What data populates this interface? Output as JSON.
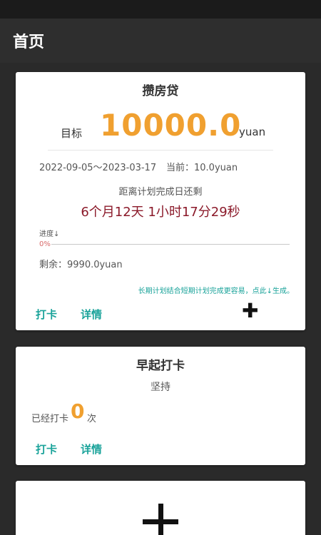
{
  "app": {
    "title": "首页"
  },
  "plan_card": {
    "title": "攒房贷",
    "target_label": "目标",
    "target_amount": "10000.0",
    "target_unit": "yuan",
    "date_range": "2022-09-05～2023-03-17",
    "current": "当前：10.0yuan",
    "remain_label": "距离计划完成日还剩",
    "countdown": "6个月12天 1小时17分29秒",
    "progress_label": "进度↓",
    "progress_percent_text": "0%",
    "progress_value": 0,
    "balance": "剩余：9990.0yuan",
    "hint": "长期计划结合短期计划完成更容易，点此↓生成。",
    "checkin_label": "打卡",
    "details_label": "详情",
    "add_icon": "plus-icon"
  },
  "habit_card": {
    "title": "早起打卡",
    "persist_label": "坚持",
    "count_prefix": "已经打卡",
    "count": "0",
    "count_suffix": "次",
    "checkin_label": "打卡",
    "details_label": "详情"
  },
  "add_card": {
    "icon": "plus-icon"
  },
  "colors": {
    "accent": "#1aa39a",
    "amount": "#f0a030",
    "countdown": "#8b1a2a",
    "progress": "#d86a6a"
  }
}
